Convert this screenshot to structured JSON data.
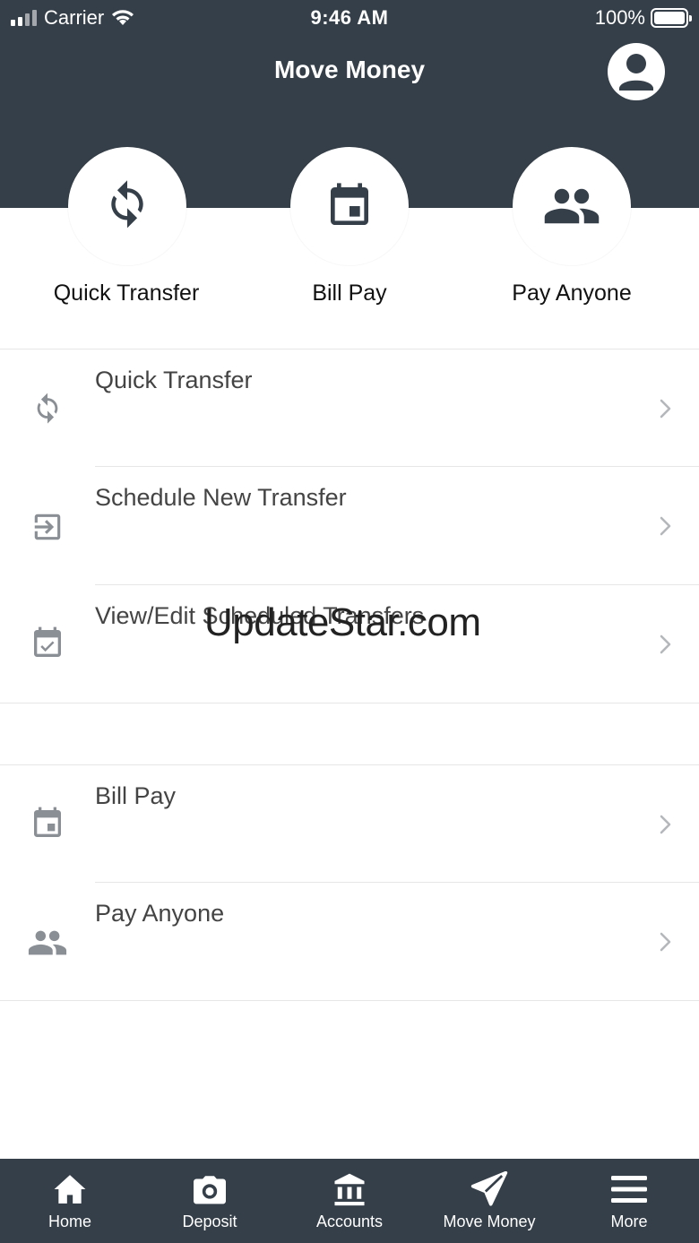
{
  "status_bar": {
    "carrier": "Carrier",
    "time": "9:46 AM",
    "battery": "100%"
  },
  "header": {
    "title": "Move Money"
  },
  "quick_actions": [
    {
      "label": "Quick Transfer",
      "icon": "refresh-icon"
    },
    {
      "label": "Bill Pay",
      "icon": "calendar-icon"
    },
    {
      "label": "Pay Anyone",
      "icon": "people-icon"
    }
  ],
  "menu_groups": [
    {
      "items": [
        {
          "label": "Quick Transfer",
          "icon": "refresh-icon"
        },
        {
          "label": "Schedule New Transfer",
          "icon": "exit-arrow-icon"
        },
        {
          "label": "View/Edit Scheduled Transfers",
          "icon": "calendar-check-icon"
        }
      ]
    },
    {
      "items": [
        {
          "label": "Bill Pay",
          "icon": "calendar-icon"
        },
        {
          "label": "Pay Anyone",
          "icon": "people-icon"
        }
      ]
    }
  ],
  "watermark": "UpdateStar.com",
  "tab_bar": {
    "active": "Move Money",
    "tabs": [
      {
        "label": "Home",
        "icon": "home-icon"
      },
      {
        "label": "Deposit",
        "icon": "camera-icon"
      },
      {
        "label": "Accounts",
        "icon": "bank-icon"
      },
      {
        "label": "Move Money",
        "icon": "send-icon"
      },
      {
        "label": "More",
        "icon": "menu-icon"
      }
    ]
  },
  "colors": {
    "header_bg": "#353f49",
    "icon_dark": "#353f49",
    "icon_muted": "#8a8f95",
    "chevron": "#b5b8bb"
  }
}
